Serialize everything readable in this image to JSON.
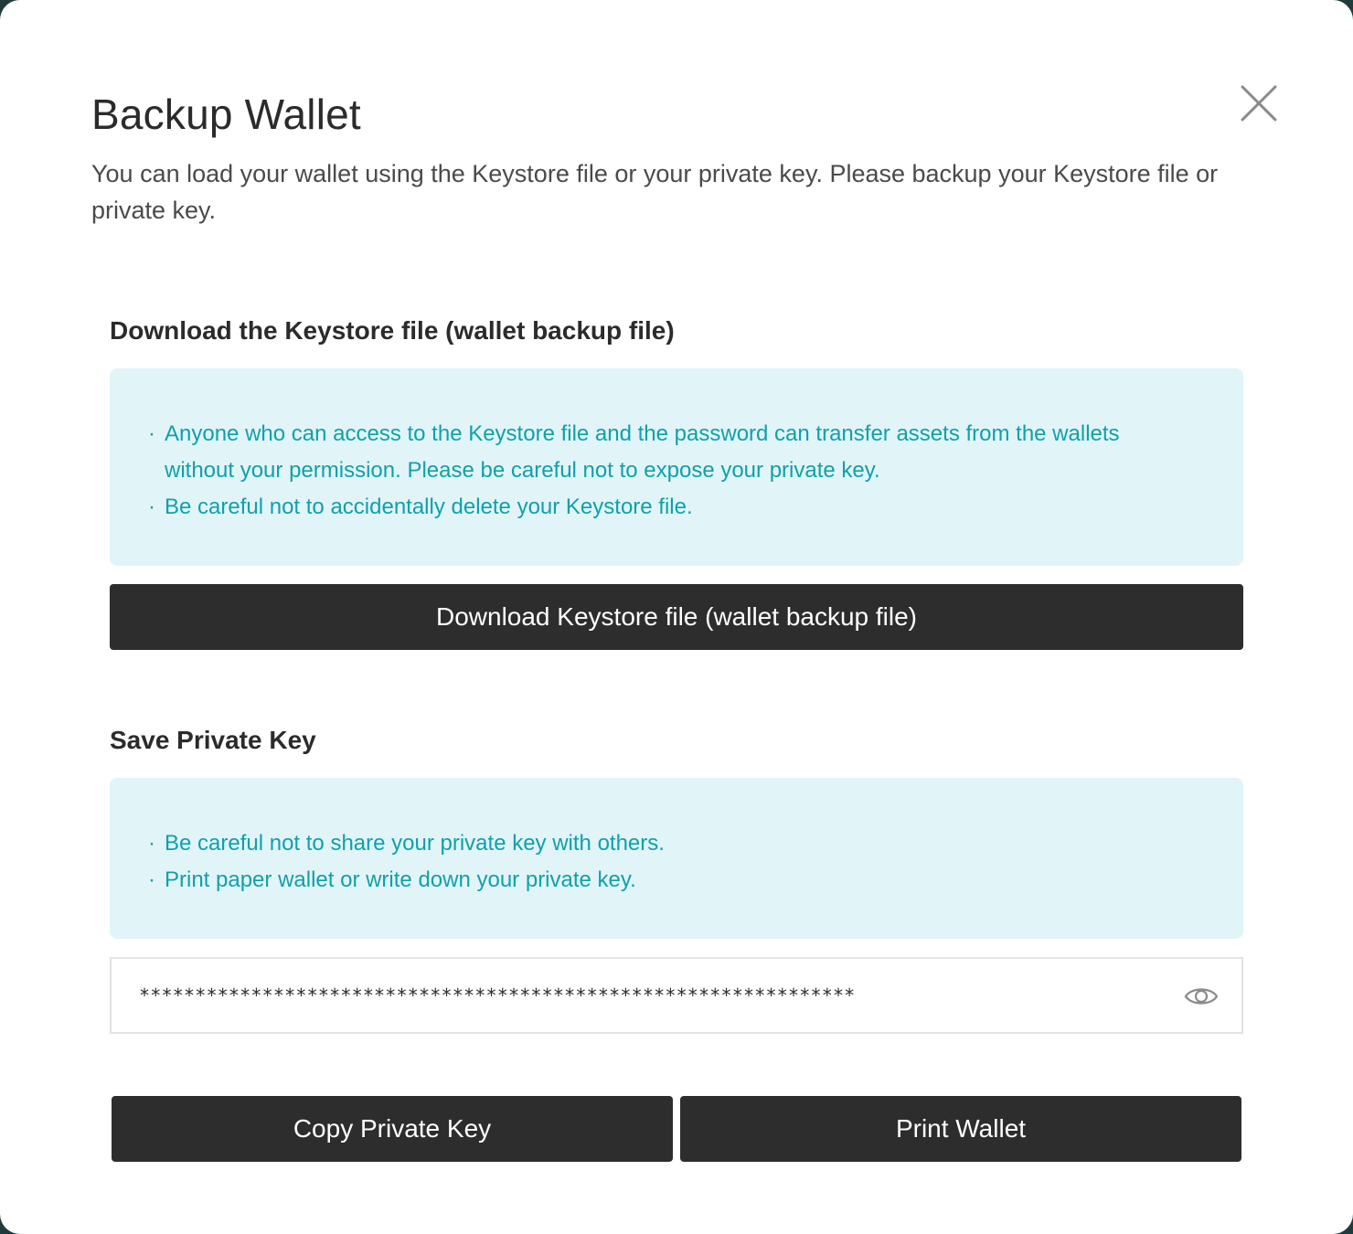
{
  "modal": {
    "title": "Backup Wallet",
    "subtitle": "You can load your wallet using the Keystore file or your private key. Please backup your Keystore file or private key.",
    "close_icon": "close-icon"
  },
  "keystore_section": {
    "title": "Download the Keystore file (wallet backup file)",
    "notes": [
      "Anyone who can access to the Keystore file and the password can transfer assets from the wallets without your permission. Please be careful not to expose your private key.",
      "Be careful not to accidentally delete your Keystore file."
    ],
    "download_button_label": "Download Keystore file (wallet backup file)"
  },
  "private_key_section": {
    "title": "Save Private Key",
    "notes": [
      "Be careful not to share your private key with others.",
      "Print paper wallet or write down your private key."
    ],
    "masked_key": "****************************************************************",
    "eye_icon": "eye-icon",
    "copy_button_label": "Copy Private Key",
    "print_button_label": "Print Wallet"
  },
  "colors": {
    "info_background": "#e1f5f8",
    "info_text": "#10a0ab",
    "button_background": "#2d2d2d",
    "button_text": "#ffffff"
  }
}
